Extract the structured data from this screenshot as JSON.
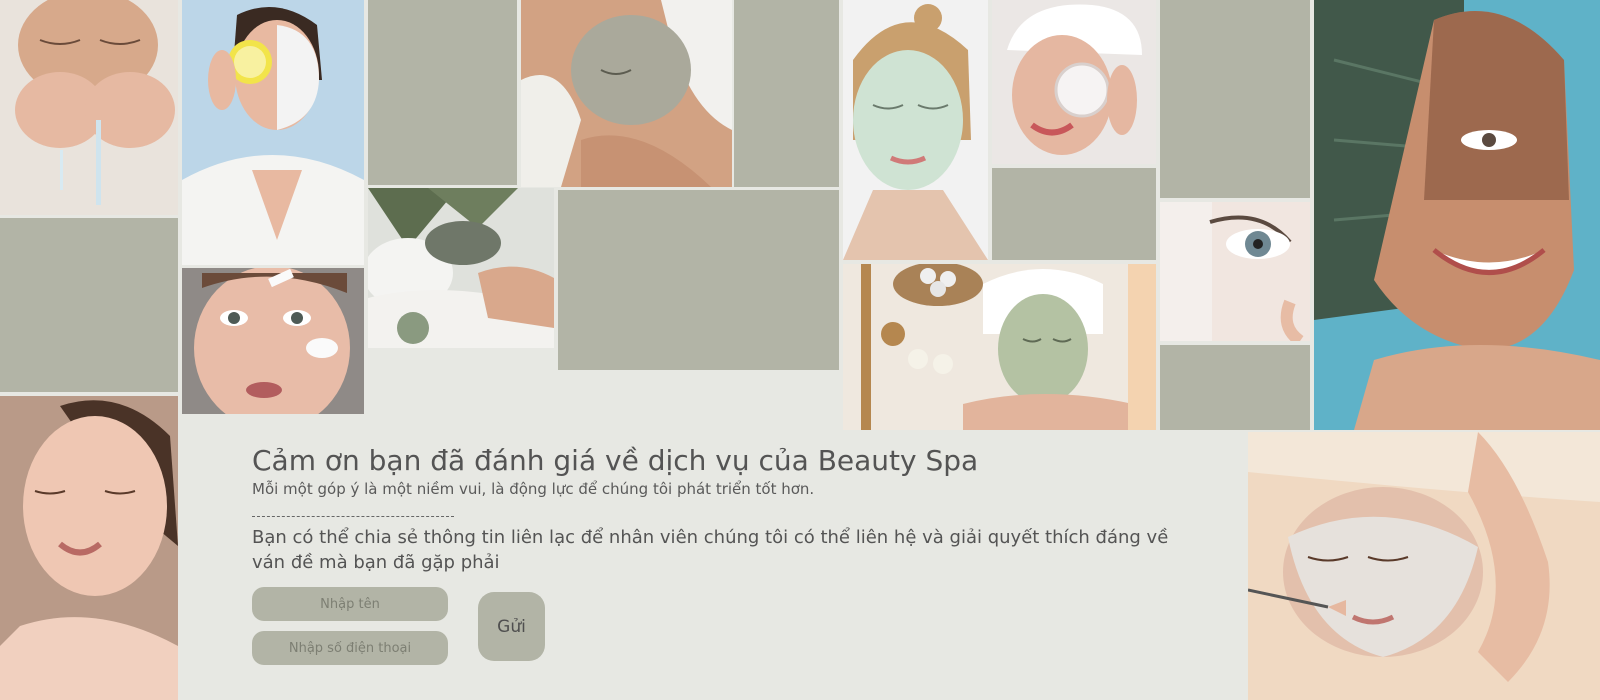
{
  "feedback": {
    "title": "Cảm ơn bạn đã đánh giá về dịch vụ của Beauty Spa",
    "subtitle": "Mỗi một góp ý là một niềm vui, là động lực để chúng tôi phát triển tốt hơn.",
    "description": "Bạn có thể chia sẻ thông tin liên lạc để nhân viên chúng tôi có thể liên hệ và giải quyết thích đáng về ván đề mà bạn đã gặp phải",
    "name_placeholder": "Nhập tên",
    "phone_placeholder": "Nhập số điện thoại",
    "submit_label": "Gửi"
  },
  "colors": {
    "background": "#e7e8e3",
    "placeholder_tile": "#b2b4a6",
    "text": "#545454"
  },
  "gallery_icons": [
    "face-washing-photo-icon",
    "lemon-face-mask-photo-icon",
    "clay-mask-towel-photo-icon",
    "peel-mask-photo-icon",
    "cream-jar-photo-icon",
    "spa-mask-lying-photo-icon",
    "mask-cheek-surprised-photo-icon",
    "spa-stones-mask-photo-icon",
    "eye-closeup-photo-icon",
    "coffee-scrub-leaf-photo-icon",
    "smiling-woman-photo-icon",
    "facial-brush-treatment-photo-icon"
  ]
}
